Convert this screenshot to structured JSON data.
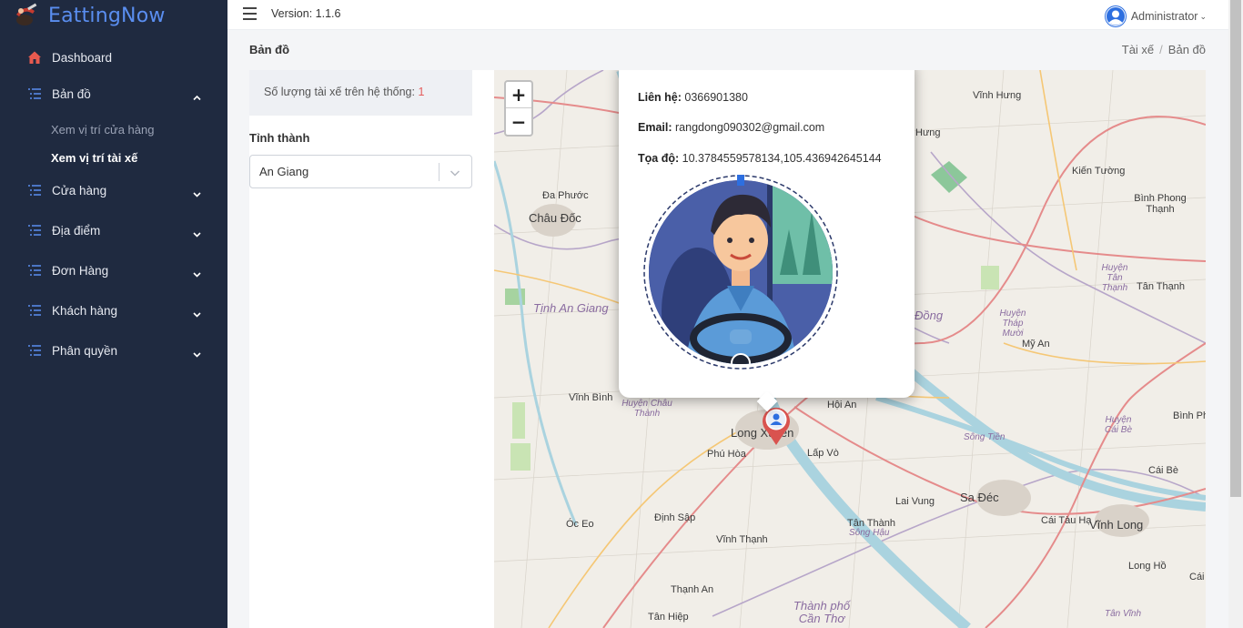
{
  "app": {
    "brand": "EattingNow",
    "version": "Version: 1.1.6"
  },
  "user": {
    "name": "Administrator"
  },
  "sidebar": {
    "items": [
      {
        "label": "Dashboard",
        "icon": "home-icon"
      },
      {
        "label": "Bản đồ",
        "icon": "list-icon",
        "expanded": true,
        "children": [
          {
            "label": "Xem vị trí cửa hàng",
            "active": false
          },
          {
            "label": "Xem vị trí tài xế",
            "active": true
          }
        ]
      },
      {
        "label": "Cửa hàng",
        "icon": "list-icon"
      },
      {
        "label": "Địa điểm",
        "icon": "list-icon"
      },
      {
        "label": "Đơn Hàng",
        "icon": "list-icon"
      },
      {
        "label": "Khách hàng",
        "icon": "list-icon"
      },
      {
        "label": "Phân quyền",
        "icon": "list-icon"
      }
    ]
  },
  "page": {
    "title": "Bản đồ",
    "breadcrumb": [
      "Tài xế",
      "Bản đồ"
    ]
  },
  "panel": {
    "count_label": "Số lượng tài xế trên hệ thống:",
    "count_value": "1",
    "province_label": "Tỉnh thành",
    "province_value": "An Giang"
  },
  "map": {
    "zoom_in": "+",
    "zoom_out": "−",
    "labels": [
      "Vĩnh Hưng",
      "Hưng",
      "Kiến Tường",
      "Bình Phong Thạnh",
      "Đa Phước",
      "Châu Đốc",
      "Tịnh An Giang",
      "Huyện Tân Thạnh",
      "Tân Thạnh",
      "Huyện Tháp Mười",
      "Mỹ An",
      "Đồng",
      "Vĩnh Bình",
      "Huyện Châu Thành",
      "Hội An",
      "Long Xuyên",
      "Phú Hòa",
      "Lấp Vò",
      "Huyện Cái Bè",
      "Bình Ph",
      "Sông Tiền",
      "Cái Bè",
      "Sa Đéc",
      "Lai Vung",
      "Óc Eo",
      "Định Sập",
      "Tân Thành",
      "Sông Hậu",
      "Cái Tàu Hạ",
      "Vĩnh Long",
      "Vĩnh Thạnh",
      "Long Hồ",
      "Thạnh An",
      "Thành phố Cần Thơ",
      "Tân Hiệp",
      "Tân Vĩnh",
      "Cái"
    ]
  },
  "popup": {
    "contact_label": "Liên hệ:",
    "contact_value": "0366901380",
    "email_label": "Email:",
    "email_value": "rangdong090302@gmail.com",
    "coord_label": "Tọa độ:",
    "coord_value": "10.3784559578134,105.436942645144"
  },
  "colors": {
    "sidebar_bg": "#1f2a40",
    "brand": "#5a8ef0",
    "accent_red": "#e45c5c",
    "marker": "#d9534f"
  }
}
